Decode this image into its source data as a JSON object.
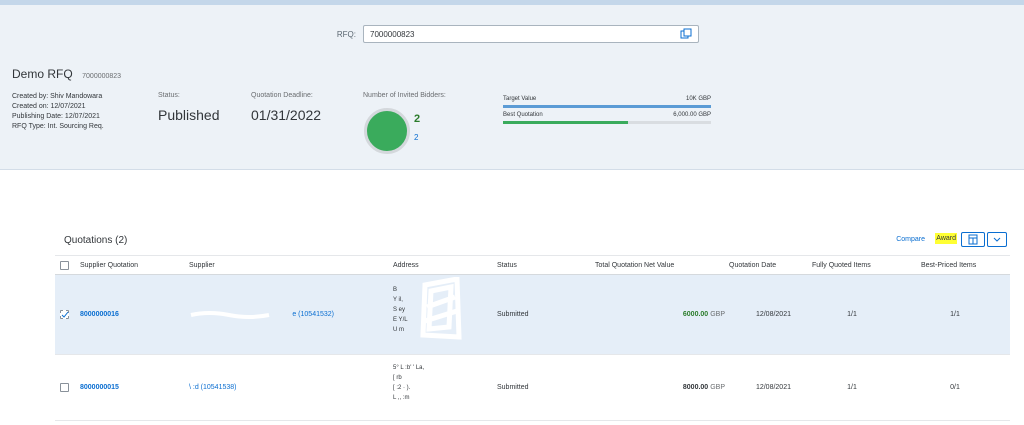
{
  "rfq_field": {
    "label": "RFQ:",
    "value": "7000000823"
  },
  "object": {
    "title": "Demo RFQ",
    "id": "7000000823",
    "created_by_label": "Created by:",
    "created_by": "Shiv Mandowara",
    "created_on": "Created on: 12/07/2021",
    "publishing_date": "Publishing Date: 12/07/2021",
    "rfq_type_label": "RFQ Type:",
    "rfq_type": "Int. Sourcing Req."
  },
  "kpis": {
    "status_label": "Status:",
    "status_value": "Published",
    "deadline_label": "Quotation Deadline:",
    "deadline_value": "01/31/2022",
    "bidders_label": "Number of Invited Bidders:",
    "bidders_value": "2",
    "bidders_sub": "2"
  },
  "comparison": {
    "target_label": "Target Value",
    "target_value": "10K GBP",
    "best_label": "Best Quotation",
    "best_value": "6,000.00 GBP",
    "target_fraction": 1.0,
    "best_fraction": 0.6,
    "target_color": "#5b9bd5",
    "best_color": "#3aab5c"
  },
  "quotations": {
    "title": "Quotations (2)",
    "compare_label": "Compare",
    "award_label": "Award",
    "columns": {
      "supplier_quotation": "Supplier Quotation",
      "supplier": "Supplier",
      "address": "Address",
      "status": "Status",
      "net_value": "Total Quotation Net Value",
      "date": "Quotation Date",
      "fully_quoted": "Fully Quoted Items",
      "best_priced": "Best-Priced Items"
    },
    "rows": [
      {
        "id": "8000000016",
        "supplier": "e (10541532)",
        "address": [
          "B",
          "Y   il,",
          "S        ey",
          "E   Y/L",
          "U             m"
        ],
        "status": "Submitted",
        "net_amount": "6000.00",
        "currency": "GBP",
        "date": "12/08/2021",
        "fully_quoted": "1/1",
        "best_priced": "1/1",
        "amount_color": "#2b7c2b"
      },
      {
        "id": "8000000015",
        "supplier": "\\                  :d (10541538)",
        "address": [
          "5° L    :b'    ' La,",
          "[ rb",
          "[ :2 ·  ).",
          "L              ,,  :m"
        ],
        "status": "Submitted",
        "net_amount": "8000.00",
        "currency": "GBP",
        "date": "12/08/2021",
        "fully_quoted": "1/1",
        "best_priced": "0/1",
        "amount_color": "#32363a"
      }
    ]
  },
  "icons": {
    "value_help": "value-help-icon",
    "table_settings": "table-settings-icon",
    "dropdown": "chevron-down-icon",
    "checkbox": "checkbox-icon"
  }
}
